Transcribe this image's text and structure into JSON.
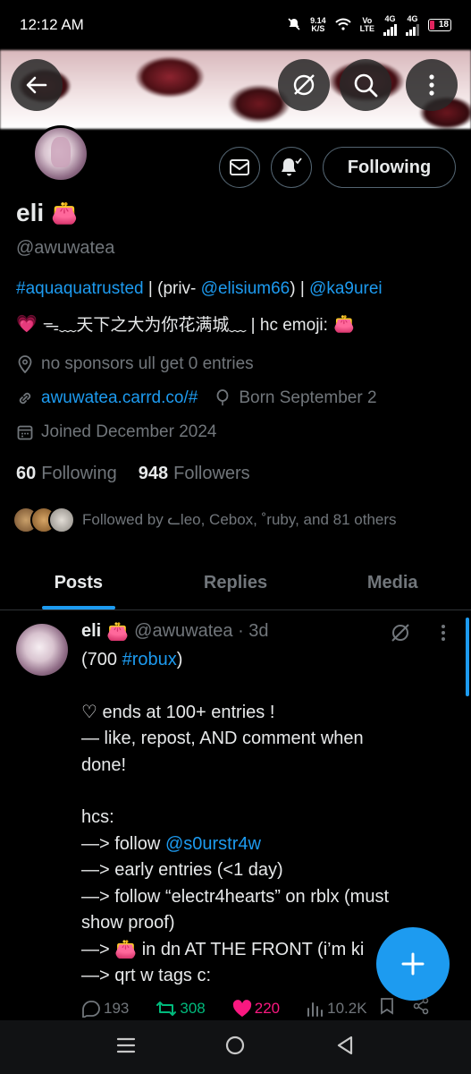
{
  "status_bar": {
    "time": "12:12 AM",
    "net_speed": "9.14",
    "net_unit": "K/S",
    "vo": "Vo",
    "lte": "LTE",
    "sim1": "4G",
    "sim2": "4G",
    "battery": "18"
  },
  "profile": {
    "name": "eli",
    "name_emoji": "👛",
    "handle": "@awuwatea",
    "following_button": "Following",
    "bio": {
      "hashtag": "#aquaquatrusted",
      "sep1": " | (priv- ",
      "priv_handle": "@elisium66",
      "sep2": ") | ",
      "alt_handle": "@ka9urei",
      "line2_heart": "💗",
      "line2_text": "⁠ᯓ﹏天下之大为你花满城﹏ | hc emoji: ",
      "line2_emoji": "👛"
    },
    "location": "no sponsors ull get 0 entries",
    "website": "awuwatea.carrd.co/#",
    "birthday": "Born September 2",
    "joined": "Joined December 2024",
    "following_count": "60",
    "following_label": "Following",
    "followers_count": "948",
    "followers_label": "Followers",
    "followed_by": "Followed by ᓚleo, Cebox, ˚ruby, and 81 others"
  },
  "tabs": [
    "Posts",
    "Replies",
    "Media"
  ],
  "post": {
    "name": "eli",
    "name_emoji": "👛",
    "meta": "@awuwatea · 3d",
    "lines": [
      {
        "text": "(700 ",
        "link": "#robux",
        "after": ")"
      },
      {
        "text": ""
      },
      {
        "text": "♡ ends at 100+ entries !"
      },
      {
        "text": "— like, repost, AND comment when"
      },
      {
        "text": "done!"
      },
      {
        "text": ""
      },
      {
        "text": "hcs:"
      },
      {
        "text": "—> follow ",
        "link": "@s0urstr4w"
      },
      {
        "text": "—> early entries (<1 day)"
      },
      {
        "text": "—> follow “electr4hearts” on rblx (must"
      },
      {
        "text": "show proof)"
      },
      {
        "text": "—> 👛 in dn AT THE FRONT (i’m ki"
      },
      {
        "text": "—> qrt w tags c:"
      }
    ],
    "replies": "193",
    "reposts": "308",
    "likes": "220",
    "views": "10.2K"
  },
  "colors": {
    "accent": "#1d9bf0",
    "repost": "#00ba7c",
    "like": "#f91880",
    "muted": "#71767b"
  }
}
